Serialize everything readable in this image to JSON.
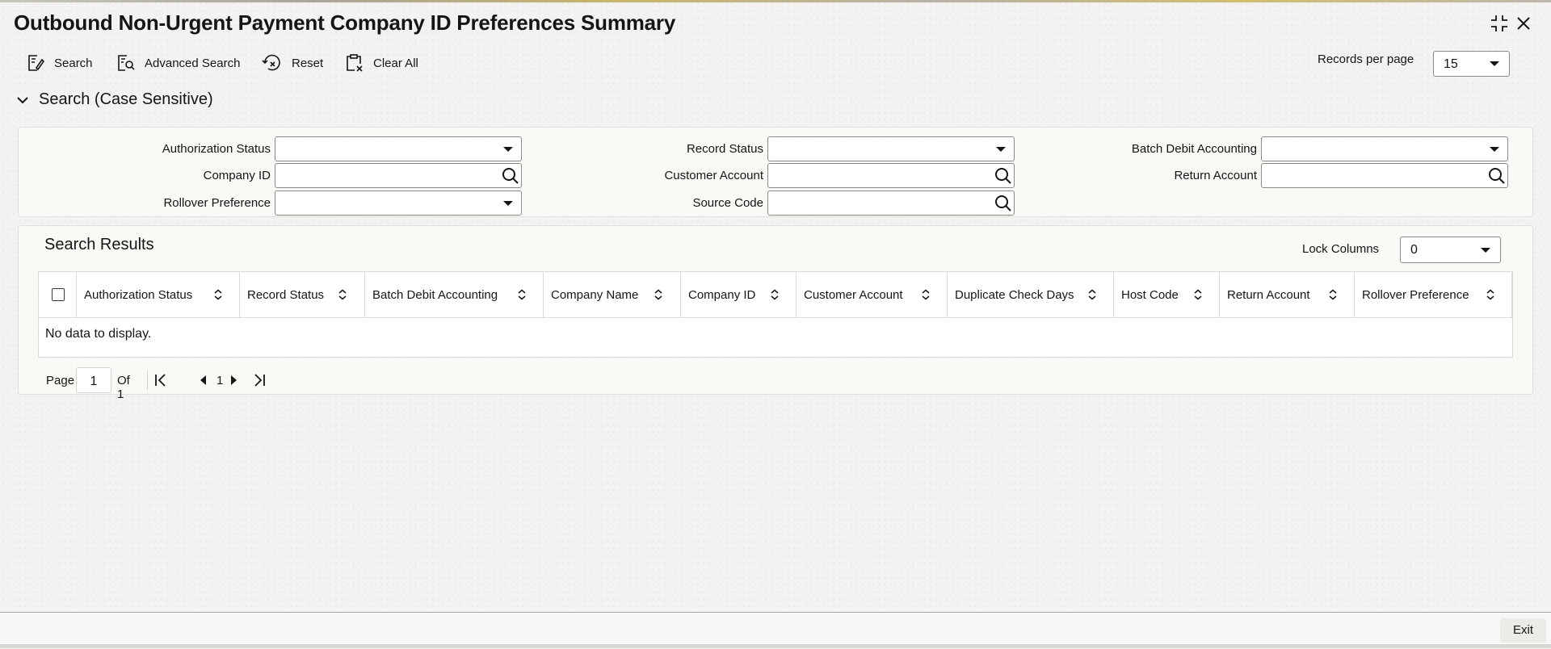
{
  "window": {
    "title": "Outbound Non-Urgent Payment Company ID Preferences Summary"
  },
  "toolbar": {
    "search_label": "Search",
    "advanced_search_label": "Advanced Search",
    "reset_label": "Reset",
    "clear_all_label": "Clear All",
    "records_per_page_label": "Records per page",
    "records_per_page_value": "15"
  },
  "search_section": {
    "title": "Search (Case Sensitive)",
    "fields": {
      "authorization_status": {
        "label": "Authorization Status",
        "value": ""
      },
      "record_status": {
        "label": "Record Status",
        "value": ""
      },
      "batch_debit_accounting": {
        "label": "Batch Debit Accounting",
        "value": ""
      },
      "company_id": {
        "label": "Company ID",
        "value": ""
      },
      "customer_account": {
        "label": "Customer Account",
        "value": ""
      },
      "return_account": {
        "label": "Return Account",
        "value": ""
      },
      "rollover_preference": {
        "label": "Rollover Preference",
        "value": ""
      },
      "source_code": {
        "label": "Source Code",
        "value": ""
      }
    }
  },
  "results": {
    "title": "Search Results",
    "lock_columns_label": "Lock Columns",
    "lock_columns_value": "0",
    "columns": [
      "Authorization Status",
      "Record Status",
      "Batch Debit Accounting",
      "Company Name",
      "Company ID",
      "Customer Account",
      "Duplicate Check Days",
      "Host Code",
      "Return Account",
      "Rollover Preference"
    ],
    "empty_message": "No data to display."
  },
  "pagination": {
    "page_label": "Page",
    "current_page": "1",
    "of_label": "Of 1",
    "page_number": "1"
  },
  "footer": {
    "exit_label": "Exit"
  }
}
